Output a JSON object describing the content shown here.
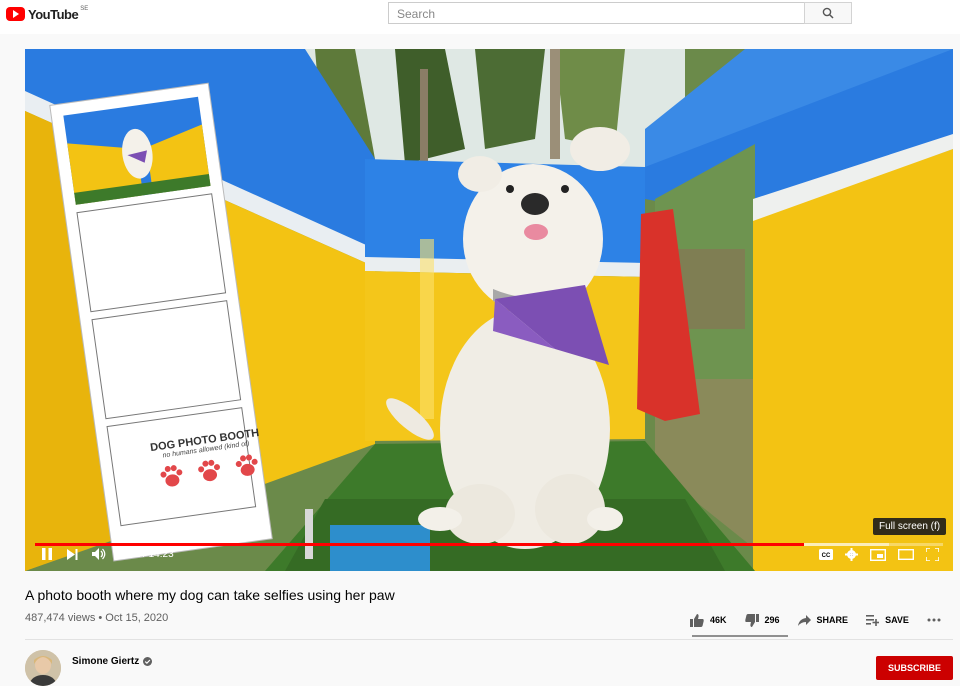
{
  "header": {
    "logo_text": "YouTube",
    "logo_country": "SE",
    "search_placeholder": "Search"
  },
  "player": {
    "strip_title": "DOG PHOTO BOOTH",
    "strip_subtitle": "no humans allowed (kind of)",
    "current_time": "12:11",
    "duration": "14:23",
    "time_display": "12:11 / 14:23",
    "progress_fraction": 0.847,
    "buffer_fraction": 0.94,
    "tooltip": "Full screen (f)",
    "icons": [
      "pause-icon",
      "next-icon",
      "volume-icon",
      "captions-icon",
      "settings-icon",
      "miniplayer-icon",
      "theater-icon",
      "fullscreen-icon"
    ]
  },
  "video": {
    "title": "A photo booth where my dog can take selfies using her paw",
    "meta": "487,474 views • Oct 15, 2020"
  },
  "actions": {
    "likes": "46K",
    "dislikes": "296",
    "share": "SHARE",
    "save": "SAVE",
    "like_fraction": 0.99
  },
  "channel": {
    "name": "Simone Giertz",
    "subscribe": "SUBSCRIBE"
  },
  "colors": {
    "brand_red": "#ff0000",
    "wall_yellow": "#f3c313",
    "wall_blue": "#2a7be0",
    "turf_green": "#3d7a2a",
    "bandana_purple": "#7c4fb3"
  }
}
